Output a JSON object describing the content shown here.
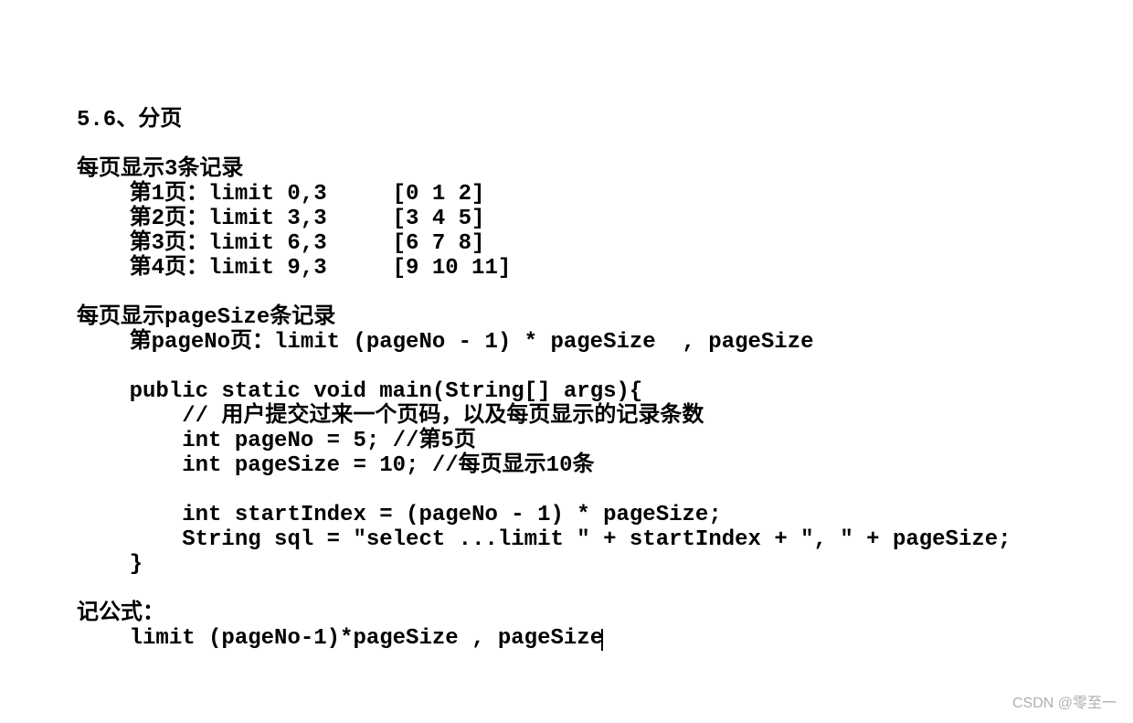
{
  "header": "5.6、分页",
  "sec1_title": "每页显示3条记录",
  "sec1_rows": [
    "    第1页：limit 0,3     [0 1 2]",
    "    第2页：limit 3,3     [3 4 5]",
    "    第3页：limit 6,3     [6 7 8]",
    "    第4页：limit 9,3     [9 10 11]"
  ],
  "sec2_title": "每页显示pageSize条记录",
  "sec2_formula": "    第pageNo页：limit (pageNo - 1) * pageSize  , pageSize",
  "code": [
    "    public static void main(String[] args){",
    "        // 用户提交过来一个页码，以及每页显示的记录条数",
    "        int pageNo = 5; //第5页",
    "        int pageSize = 10; //每页显示10条",
    "",
    "        int startIndex = (pageNo - 1) * pageSize;",
    "        String sql = \"select ...limit \" + startIndex + \", \" + pageSize;",
    "    }"
  ],
  "sec3_title": "记公式：",
  "sec3_formula": "    limit (pageNo-1)*pageSize , pageSize",
  "watermark": "CSDN @零至一"
}
